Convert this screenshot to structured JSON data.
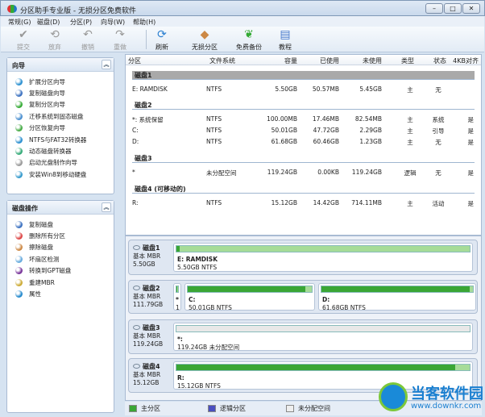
{
  "window": {
    "title": "分区助手专业版 - 无损分区免费软件"
  },
  "menu": [
    "常规(G)",
    "磁盘(D)",
    "分区(P)",
    "向导(W)",
    "帮助(H)"
  ],
  "toolbar": [
    {
      "label": "提交",
      "icon": "check-icon",
      "enabled": false
    },
    {
      "label": "放弃",
      "icon": "discard-icon",
      "enabled": false
    },
    {
      "label": "撤销",
      "icon": "undo-icon",
      "enabled": false
    },
    {
      "label": "重做",
      "icon": "redo-icon",
      "enabled": false
    },
    {
      "label": "刷新",
      "icon": "refresh-icon",
      "enabled": true
    },
    {
      "label": "无损分区",
      "icon": "partition-icon",
      "enabled": true
    },
    {
      "label": "免费备份",
      "icon": "backup-icon",
      "enabled": true
    },
    {
      "label": "教程",
      "icon": "tutorial-icon",
      "enabled": true
    }
  ],
  "wizard_panel": {
    "title": "向导",
    "items": [
      "扩展分区向导",
      "复制磁盘向导",
      "复制分区向导",
      "迁移系统到固态磁盘",
      "分区恢复向导",
      "NTFS与FAT32转换器",
      "动态磁盘转换器",
      "启动光盘制作向导",
      "安装Win8到移动硬盘"
    ]
  },
  "disk_ops_panel": {
    "title": "磁盘操作",
    "items": [
      "复制磁盘",
      "删除所有分区",
      "擦除磁盘",
      "坏扇区检测",
      "转换到GPT磁盘",
      "重建MBR",
      "属性"
    ]
  },
  "table": {
    "headers": [
      "分区",
      "文件系统",
      "容量",
      "已使用",
      "未使用",
      "类型",
      "状态",
      "4KB对齐"
    ],
    "disks": [
      {
        "name": "磁盘1",
        "rows": [
          [
            "E: RAMDISK",
            "NTFS",
            "5.50GB",
            "50.57MB",
            "5.45GB",
            "主",
            "无",
            ""
          ]
        ]
      },
      {
        "name": "磁盘2",
        "rows": [
          [
            "*: 系统保留",
            "NTFS",
            "100.00MB",
            "17.46MB",
            "82.54MB",
            "主",
            "系统",
            "是"
          ],
          [
            "C:",
            "NTFS",
            "50.01GB",
            "47.72GB",
            "2.29GB",
            "主",
            "引导",
            "是"
          ],
          [
            "D:",
            "NTFS",
            "61.68GB",
            "60.46GB",
            "1.23GB",
            "主",
            "无",
            "是"
          ]
        ]
      },
      {
        "name": "磁盘3",
        "rows": [
          [
            "*",
            "未分配空间",
            "119.24GB",
            "0.00KB",
            "119.24GB",
            "逻辑",
            "无",
            "是"
          ]
        ]
      },
      {
        "name": "磁盘4 (可移动的)",
        "rows": [
          [
            "R:",
            "NTFS",
            "15.12GB",
            "14.42GB",
            "714.11MB",
            "主",
            "活动",
            "是"
          ]
        ]
      }
    ]
  },
  "graph": [
    {
      "name": "磁盘1",
      "type": "基本 MBR",
      "size": "5.50GB",
      "parts": [
        {
          "label": "E: RAMDISK",
          "desc": "5.50GB NTFS",
          "used": 0.01,
          "kind": "primary"
        }
      ]
    },
    {
      "name": "磁盘2",
      "type": "基本 MBR",
      "size": "111.79GB",
      "parts": [
        {
          "label": "*",
          "desc": "1",
          "used": 0.2,
          "kind": "primary"
        },
        {
          "label": "C:",
          "desc": "50.01GB NTFS",
          "used": 0.95,
          "kind": "primary"
        },
        {
          "label": "D:",
          "desc": "61.68GB NTFS",
          "used": 0.98,
          "kind": "primary"
        }
      ]
    },
    {
      "name": "磁盘3",
      "type": "基本 MBR",
      "size": "119.24GB",
      "parts": [
        {
          "label": "*:",
          "desc": "119.24GB 未分配空间",
          "used": 0,
          "kind": "unallocated"
        }
      ]
    },
    {
      "name": "磁盘4",
      "type": "基本 MBR",
      "size": "15.12GB",
      "parts": [
        {
          "label": "R:",
          "desc": "15.12GB NTFS",
          "used": 0.95,
          "kind": "primary"
        }
      ]
    }
  ],
  "legend": [
    "主分区",
    "逻辑分区",
    "未分配空间"
  ],
  "watermark": {
    "name": "当客软件园",
    "url": "www.downkr.com"
  },
  "colors": {
    "primary": "#3aa635",
    "logical": "#4a4fc0",
    "unallocated": "#e6e6e6"
  }
}
